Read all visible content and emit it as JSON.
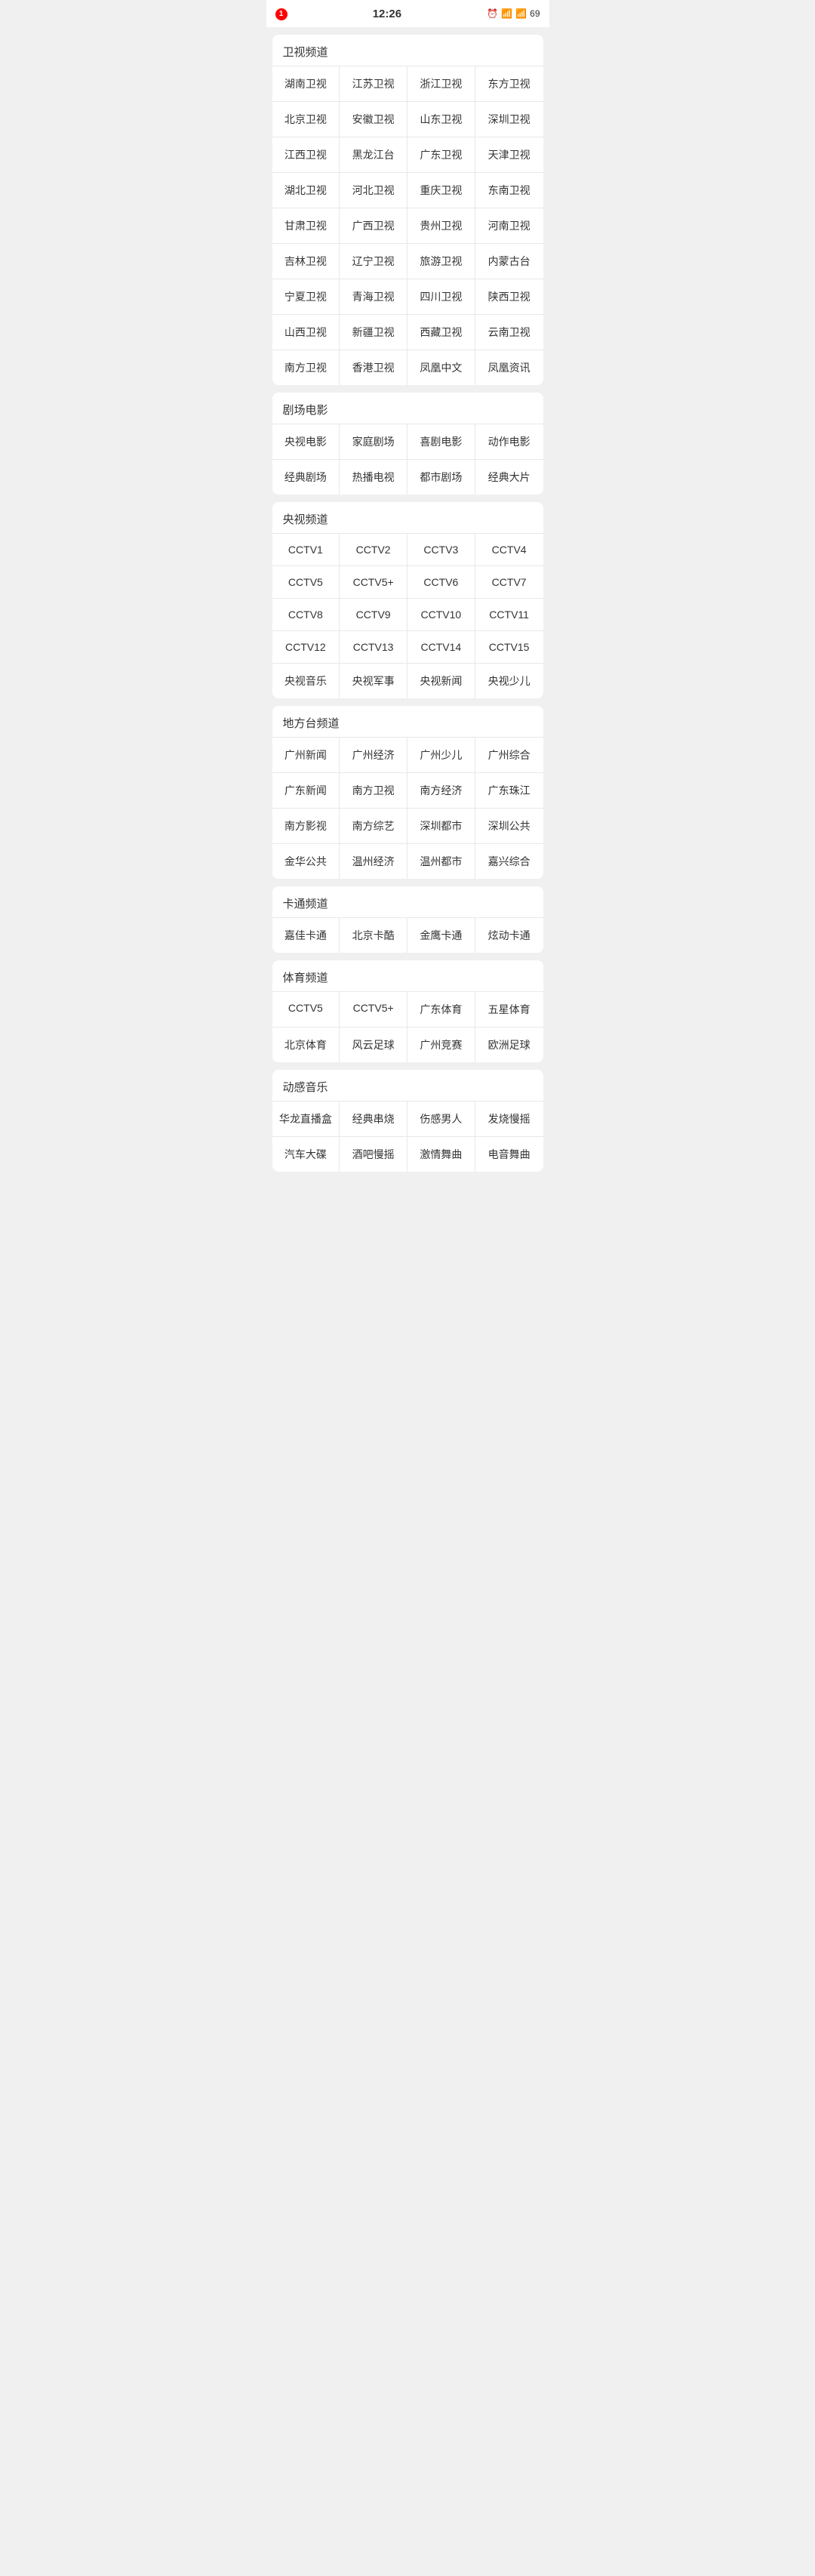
{
  "statusBar": {
    "left": "1",
    "center": "12:26",
    "right": "69"
  },
  "sections": [
    {
      "id": "satellite",
      "title": "卫视频道",
      "channels": [
        "湖南卫视",
        "江苏卫视",
        "浙江卫视",
        "东方卫视",
        "北京卫视",
        "安徽卫视",
        "山东卫视",
        "深圳卫视",
        "江西卫视",
        "黑龙江台",
        "广东卫视",
        "天津卫视",
        "湖北卫视",
        "河北卫视",
        "重庆卫视",
        "东南卫视",
        "甘肃卫视",
        "广西卫视",
        "贵州卫视",
        "河南卫视",
        "吉林卫视",
        "辽宁卫视",
        "旅游卫视",
        "内蒙古台",
        "宁夏卫视",
        "青海卫视",
        "四川卫视",
        "陕西卫视",
        "山西卫视",
        "新疆卫视",
        "西藏卫视",
        "云南卫视",
        "南方卫视",
        "香港卫视",
        "凤凰中文",
        "凤凰资讯"
      ]
    },
    {
      "id": "movies",
      "title": "剧场电影",
      "channels": [
        "央视电影",
        "家庭剧场",
        "喜剧电影",
        "动作电影",
        "经典剧场",
        "热播电视",
        "都市剧场",
        "经典大片"
      ]
    },
    {
      "id": "cctv",
      "title": "央视频道",
      "channels": [
        "CCTV1",
        "CCTV2",
        "CCTV3",
        "CCTV4",
        "CCTV5",
        "CCTV5+",
        "CCTV6",
        "CCTV7",
        "CCTV8",
        "CCTV9",
        "CCTV10",
        "CCTV11",
        "CCTV12",
        "CCTV13",
        "CCTV14",
        "CCTV15",
        "央视音乐",
        "央视军事",
        "央视新闻",
        "央视少儿"
      ]
    },
    {
      "id": "local",
      "title": "地方台频道",
      "channels": [
        "广州新闻",
        "广州经济",
        "广州少儿",
        "广州综合",
        "广东新闻",
        "南方卫视",
        "南方经济",
        "广东珠江",
        "南方影视",
        "南方综艺",
        "深圳都市",
        "深圳公共",
        "金华公共",
        "温州经济",
        "温州都市",
        "嘉兴综合"
      ]
    },
    {
      "id": "cartoon",
      "title": "卡通频道",
      "channels": [
        "嘉佳卡通",
        "北京卡酷",
        "金鹰卡通",
        "炫动卡通"
      ]
    },
    {
      "id": "sports",
      "title": "体育频道",
      "channels": [
        "CCTV5",
        "CCTV5+",
        "广东体育",
        "五星体育",
        "北京体育",
        "风云足球",
        "广州竞赛",
        "欧洲足球"
      ]
    },
    {
      "id": "music",
      "title": "动感音乐",
      "channels": [
        "华龙直播盒",
        "经典串烧",
        "伤感男人",
        "发烧慢摇",
        "汽车大碟",
        "酒吧慢摇",
        "激情舞曲",
        "电音舞曲"
      ]
    }
  ]
}
